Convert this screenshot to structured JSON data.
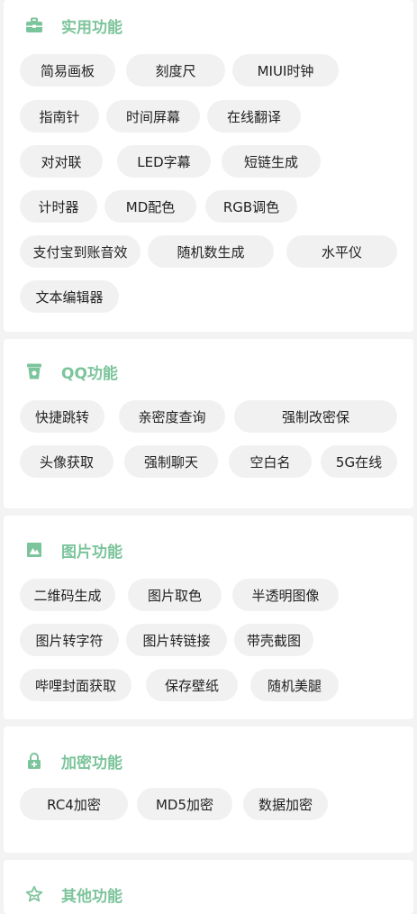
{
  "sections": [
    {
      "title": "实用功能",
      "icon": "toolbox-icon",
      "items": [
        "简易画板",
        "刻度尺",
        "MIUI时钟",
        "指南针",
        "时间屏幕",
        "在线翻译",
        "对对联",
        "LED字幕",
        "短链生成",
        "计时器",
        "MD配色",
        "RGB调色",
        "支付宝到账音效",
        "随机数生成",
        "水平仪",
        "文本编辑器"
      ]
    },
    {
      "title": "QQ功能",
      "icon": "cup-icon",
      "items": [
        "快捷跳转",
        "亲密度查询",
        "强制改密保",
        "头像获取",
        "强制聊天",
        "空白名",
        "5G在线"
      ]
    },
    {
      "title": "图片功能",
      "icon": "image-icon",
      "items": [
        "二维码生成",
        "图片取色",
        "半透明图像",
        "图片转字符",
        "图片转链接",
        "带壳截图",
        "哔哩封面获取",
        "保存壁纸",
        "随机美腿"
      ]
    },
    {
      "title": "加密功能",
      "icon": "lock-icon",
      "items": [
        "RC4加密",
        "MD5加密",
        "数据加密"
      ]
    },
    {
      "title": "其他功能",
      "icon": "star-icon",
      "items": []
    }
  ],
  "colors": {
    "accent": "#7cc49b",
    "chip_bg": "#f1f1f1",
    "page_bg": "#f3f3f3"
  }
}
